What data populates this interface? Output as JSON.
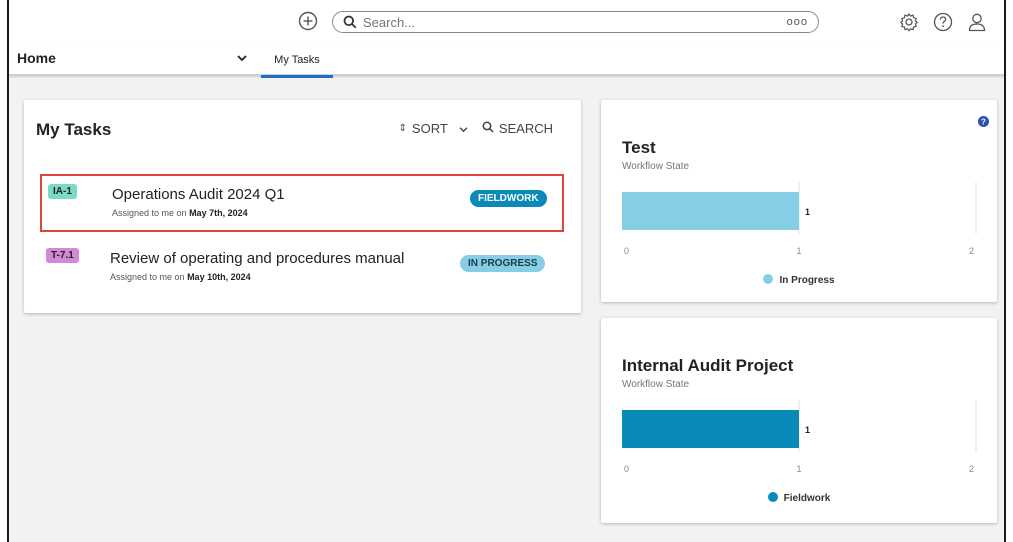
{
  "topbar": {
    "search_placeholder": "Search...",
    "more_label": "ooo"
  },
  "nav": {
    "home_label": "Home",
    "tab_label": "My Tasks"
  },
  "tasks_card": {
    "title": "My Tasks",
    "sort_label": "SORT",
    "search_label": "SEARCH",
    "items": [
      {
        "id": "IA-1",
        "id_color": "#7ad9c7",
        "name": "Operations Audit 2024 Q1",
        "assigned_prefix": "Assigned to me on",
        "assigned_date": "May 7th, 2024",
        "state": "FIELDWORK",
        "state_color": "#0a8ab8",
        "state_text_color": "#ffffff"
      },
      {
        "id": "T-7.1",
        "id_color": "#d08ad6",
        "name": "Review of operating and procedures manual",
        "assigned_prefix": "Assigned to me on",
        "assigned_date": "May 10th, 2024",
        "state": "IN PROGRESS",
        "state_color": "#86cee6",
        "state_text_color": "#1a3a4a"
      }
    ]
  },
  "chart_data": [
    {
      "type": "bar",
      "title": "Test",
      "subtitle": "Workflow State",
      "orientation": "horizontal",
      "series": [
        {
          "name": "In Progress",
          "values": [
            1
          ],
          "color": "#86cee6"
        }
      ],
      "data_label": "1",
      "xlim": [
        0,
        2
      ],
      "x_ticks": [
        "0",
        "1",
        "2"
      ]
    },
    {
      "type": "bar",
      "title": "Internal Audit Project",
      "subtitle": "Workflow State",
      "orientation": "horizontal",
      "series": [
        {
          "name": "Fieldwork",
          "values": [
            1
          ],
          "color": "#0a8ab8"
        }
      ],
      "data_label": "1",
      "xlim": [
        0,
        2
      ],
      "x_ticks": [
        "0",
        "1",
        "2"
      ]
    }
  ],
  "icons": {
    "add": "add-icon",
    "search": "search-icon",
    "settings": "gear-icon",
    "help": "help-icon",
    "user": "user-icon",
    "sort": "sort-icon",
    "chart_help": "question-icon"
  }
}
